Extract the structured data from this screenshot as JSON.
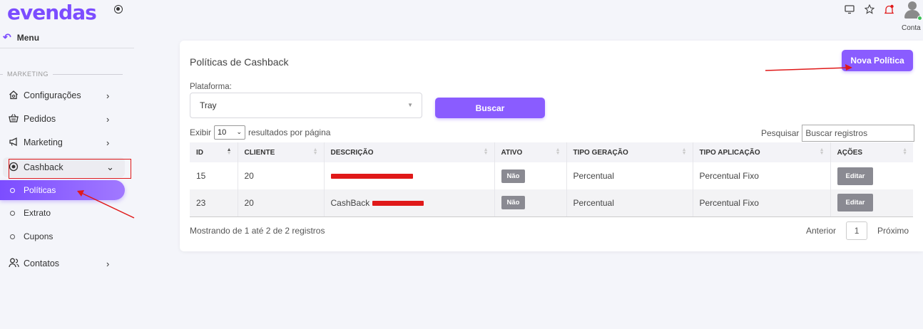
{
  "brand": {
    "logo_text": "evendas",
    "accent": "#7c4dff",
    "status_red": "#e01919"
  },
  "topbar": {
    "icons": [
      "monitor-icon",
      "star-icon",
      "bell-icon",
      "user-avatar-icon"
    ],
    "account_label": "Conta"
  },
  "sidebar": {
    "menu_label": "Menu",
    "section_label": "MARKETING",
    "items": [
      {
        "label": "Configurações",
        "icon": "home-settings-icon",
        "chevron": "›"
      },
      {
        "label": "Pedidos",
        "icon": "basket-icon",
        "chevron": "›"
      },
      {
        "label": "Marketing",
        "icon": "megaphone-icon",
        "chevron": "›"
      },
      {
        "label": "Cashback",
        "icon": "cashback-icon",
        "chevron": "⌄"
      }
    ],
    "cashback_sub": [
      {
        "label": "Políticas",
        "active": true
      },
      {
        "label": "Extrato",
        "active": false
      },
      {
        "label": "Cupons",
        "active": false
      }
    ],
    "contacts": {
      "label": "Contatos",
      "icon": "contacts-icon",
      "chevron": "›"
    }
  },
  "card": {
    "title": "Políticas de Cashback",
    "new_button": "Nova Política",
    "platform_label": "Plataforma:",
    "platform_value": "Tray",
    "search_button": "Buscar",
    "length": {
      "prefix": "Exibir",
      "value": "10",
      "suffix": "resultados por página"
    },
    "search": {
      "label": "Pesquisar",
      "placeholder": "Buscar registros"
    },
    "table": {
      "headers": [
        "ID",
        "CLIENTE",
        "DESCRIÇÃO",
        "ATIVO",
        "TIPO GERAÇÃO",
        "TIPO APLICAÇÃO",
        "AÇÕES"
      ],
      "rows": [
        {
          "id": "15",
          "cliente": "20",
          "descricao": "",
          "ativo": "Não",
          "tipo_geracao": "Percentual",
          "tipo_aplicacao": "Percentual Fixo",
          "acao": "Editar"
        },
        {
          "id": "23",
          "cliente": "20",
          "descricao": "CashBack",
          "ativo": "Não",
          "tipo_geracao": "Percentual",
          "tipo_aplicacao": "Percentual Fixo",
          "acao": "Editar"
        }
      ]
    },
    "info": "Mostrando de 1 até 2 de 2 registros",
    "pagination": {
      "prev": "Anterior",
      "page": "1",
      "next": "Próximo"
    }
  }
}
